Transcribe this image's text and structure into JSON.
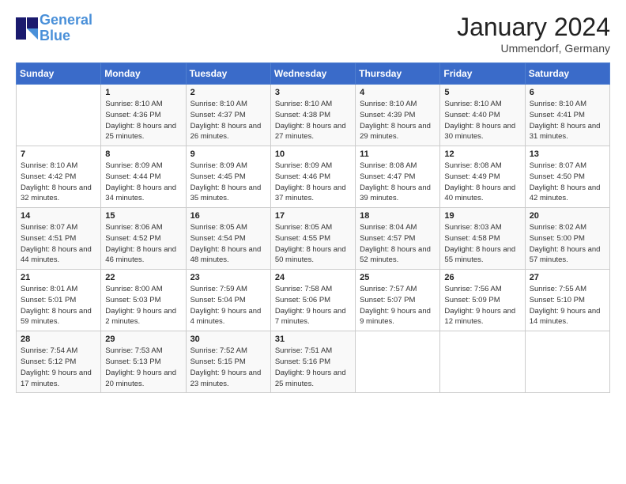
{
  "header": {
    "logo_line1": "General",
    "logo_line2": "Blue",
    "month": "January 2024",
    "location": "Ummendorf, Germany"
  },
  "weekdays": [
    "Sunday",
    "Monday",
    "Tuesday",
    "Wednesday",
    "Thursday",
    "Friday",
    "Saturday"
  ],
  "weeks": [
    [
      {
        "day": "",
        "sunrise": "",
        "sunset": "",
        "daylight": ""
      },
      {
        "day": "1",
        "sunrise": "Sunrise: 8:10 AM",
        "sunset": "Sunset: 4:36 PM",
        "daylight": "Daylight: 8 hours and 25 minutes."
      },
      {
        "day": "2",
        "sunrise": "Sunrise: 8:10 AM",
        "sunset": "Sunset: 4:37 PM",
        "daylight": "Daylight: 8 hours and 26 minutes."
      },
      {
        "day": "3",
        "sunrise": "Sunrise: 8:10 AM",
        "sunset": "Sunset: 4:38 PM",
        "daylight": "Daylight: 8 hours and 27 minutes."
      },
      {
        "day": "4",
        "sunrise": "Sunrise: 8:10 AM",
        "sunset": "Sunset: 4:39 PM",
        "daylight": "Daylight: 8 hours and 29 minutes."
      },
      {
        "day": "5",
        "sunrise": "Sunrise: 8:10 AM",
        "sunset": "Sunset: 4:40 PM",
        "daylight": "Daylight: 8 hours and 30 minutes."
      },
      {
        "day": "6",
        "sunrise": "Sunrise: 8:10 AM",
        "sunset": "Sunset: 4:41 PM",
        "daylight": "Daylight: 8 hours and 31 minutes."
      }
    ],
    [
      {
        "day": "7",
        "sunrise": "Sunrise: 8:10 AM",
        "sunset": "Sunset: 4:42 PM",
        "daylight": "Daylight: 8 hours and 32 minutes."
      },
      {
        "day": "8",
        "sunrise": "Sunrise: 8:09 AM",
        "sunset": "Sunset: 4:44 PM",
        "daylight": "Daylight: 8 hours and 34 minutes."
      },
      {
        "day": "9",
        "sunrise": "Sunrise: 8:09 AM",
        "sunset": "Sunset: 4:45 PM",
        "daylight": "Daylight: 8 hours and 35 minutes."
      },
      {
        "day": "10",
        "sunrise": "Sunrise: 8:09 AM",
        "sunset": "Sunset: 4:46 PM",
        "daylight": "Daylight: 8 hours and 37 minutes."
      },
      {
        "day": "11",
        "sunrise": "Sunrise: 8:08 AM",
        "sunset": "Sunset: 4:47 PM",
        "daylight": "Daylight: 8 hours and 39 minutes."
      },
      {
        "day": "12",
        "sunrise": "Sunrise: 8:08 AM",
        "sunset": "Sunset: 4:49 PM",
        "daylight": "Daylight: 8 hours and 40 minutes."
      },
      {
        "day": "13",
        "sunrise": "Sunrise: 8:07 AM",
        "sunset": "Sunset: 4:50 PM",
        "daylight": "Daylight: 8 hours and 42 minutes."
      }
    ],
    [
      {
        "day": "14",
        "sunrise": "Sunrise: 8:07 AM",
        "sunset": "Sunset: 4:51 PM",
        "daylight": "Daylight: 8 hours and 44 minutes."
      },
      {
        "day": "15",
        "sunrise": "Sunrise: 8:06 AM",
        "sunset": "Sunset: 4:52 PM",
        "daylight": "Daylight: 8 hours and 46 minutes."
      },
      {
        "day": "16",
        "sunrise": "Sunrise: 8:05 AM",
        "sunset": "Sunset: 4:54 PM",
        "daylight": "Daylight: 8 hours and 48 minutes."
      },
      {
        "day": "17",
        "sunrise": "Sunrise: 8:05 AM",
        "sunset": "Sunset: 4:55 PM",
        "daylight": "Daylight: 8 hours and 50 minutes."
      },
      {
        "day": "18",
        "sunrise": "Sunrise: 8:04 AM",
        "sunset": "Sunset: 4:57 PM",
        "daylight": "Daylight: 8 hours and 52 minutes."
      },
      {
        "day": "19",
        "sunrise": "Sunrise: 8:03 AM",
        "sunset": "Sunset: 4:58 PM",
        "daylight": "Daylight: 8 hours and 55 minutes."
      },
      {
        "day": "20",
        "sunrise": "Sunrise: 8:02 AM",
        "sunset": "Sunset: 5:00 PM",
        "daylight": "Daylight: 8 hours and 57 minutes."
      }
    ],
    [
      {
        "day": "21",
        "sunrise": "Sunrise: 8:01 AM",
        "sunset": "Sunset: 5:01 PM",
        "daylight": "Daylight: 8 hours and 59 minutes."
      },
      {
        "day": "22",
        "sunrise": "Sunrise: 8:00 AM",
        "sunset": "Sunset: 5:03 PM",
        "daylight": "Daylight: 9 hours and 2 minutes."
      },
      {
        "day": "23",
        "sunrise": "Sunrise: 7:59 AM",
        "sunset": "Sunset: 5:04 PM",
        "daylight": "Daylight: 9 hours and 4 minutes."
      },
      {
        "day": "24",
        "sunrise": "Sunrise: 7:58 AM",
        "sunset": "Sunset: 5:06 PM",
        "daylight": "Daylight: 9 hours and 7 minutes."
      },
      {
        "day": "25",
        "sunrise": "Sunrise: 7:57 AM",
        "sunset": "Sunset: 5:07 PM",
        "daylight": "Daylight: 9 hours and 9 minutes."
      },
      {
        "day": "26",
        "sunrise": "Sunrise: 7:56 AM",
        "sunset": "Sunset: 5:09 PM",
        "daylight": "Daylight: 9 hours and 12 minutes."
      },
      {
        "day": "27",
        "sunrise": "Sunrise: 7:55 AM",
        "sunset": "Sunset: 5:10 PM",
        "daylight": "Daylight: 9 hours and 14 minutes."
      }
    ],
    [
      {
        "day": "28",
        "sunrise": "Sunrise: 7:54 AM",
        "sunset": "Sunset: 5:12 PM",
        "daylight": "Daylight: 9 hours and 17 minutes."
      },
      {
        "day": "29",
        "sunrise": "Sunrise: 7:53 AM",
        "sunset": "Sunset: 5:13 PM",
        "daylight": "Daylight: 9 hours and 20 minutes."
      },
      {
        "day": "30",
        "sunrise": "Sunrise: 7:52 AM",
        "sunset": "Sunset: 5:15 PM",
        "daylight": "Daylight: 9 hours and 23 minutes."
      },
      {
        "day": "31",
        "sunrise": "Sunrise: 7:51 AM",
        "sunset": "Sunset: 5:16 PM",
        "daylight": "Daylight: 9 hours and 25 minutes."
      },
      {
        "day": "",
        "sunrise": "",
        "sunset": "",
        "daylight": ""
      },
      {
        "day": "",
        "sunrise": "",
        "sunset": "",
        "daylight": ""
      },
      {
        "day": "",
        "sunrise": "",
        "sunset": "",
        "daylight": ""
      }
    ]
  ]
}
